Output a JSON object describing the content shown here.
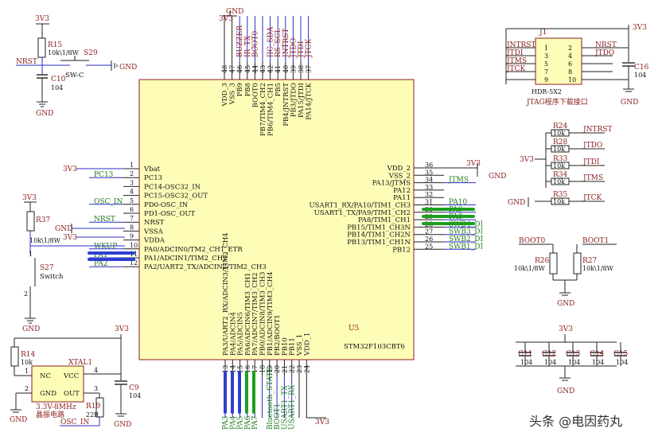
{
  "mcu": {
    "ref": "U5",
    "part": "STM32F103CBT6",
    "left_pins": [
      {
        "num": "1",
        "name": "Vbat"
      },
      {
        "num": "2",
        "name": "PC13"
      },
      {
        "num": "3",
        "name": "PC14-OSC32_IN"
      },
      {
        "num": "4",
        "name": "PC15-OSC32_OUT"
      },
      {
        "num": "5",
        "name": "PD0-OSC_IN"
      },
      {
        "num": "6",
        "name": "PD1-OSC_OUT"
      },
      {
        "num": "7",
        "name": "NRST"
      },
      {
        "num": "8",
        "name": "VSSA"
      },
      {
        "num": "9",
        "name": "VDDA"
      },
      {
        "num": "10",
        "name": "PA0/ADCIN0/TM2_CH1_ETR"
      },
      {
        "num": "11",
        "name": "PA1/ADCIN1/TIM2_CH2"
      },
      {
        "num": "12",
        "name": "PA2/UART2_TX/ADCIN2/TIM2_CH3"
      }
    ],
    "right_pins": [
      {
        "num": "36",
        "name": "VDD_2"
      },
      {
        "num": "35",
        "name": "VSS_2"
      },
      {
        "num": "34",
        "name": "PA13/JTMS"
      },
      {
        "num": "33",
        "name": "PA12"
      },
      {
        "num": "32",
        "name": "PA11"
      },
      {
        "num": "31",
        "name": "USART1_RX/PA10/TIM1_CH3"
      },
      {
        "num": "30",
        "name": "USART1_TX/PA9/TIM1_CH2"
      },
      {
        "num": "29",
        "name": "PA8/TIM1_CH1"
      },
      {
        "num": "28",
        "name": "PB15/TIM1_CH3N"
      },
      {
        "num": "27",
        "name": "PB14/TIM1_CH2N"
      },
      {
        "num": "26",
        "name": "PB13/TIM1_CH1N"
      },
      {
        "num": "25",
        "name": "PB12"
      }
    ],
    "top_pins": [
      {
        "num": "48",
        "name": "VDD_3"
      },
      {
        "num": "47",
        "name": "VSS_3"
      },
      {
        "num": "46",
        "name": "PB9"
      },
      {
        "num": "45",
        "name": "PB8"
      },
      {
        "num": "44",
        "name": "BOOT0"
      },
      {
        "num": "43",
        "name": "PB7/TIM4_CH2"
      },
      {
        "num": "42",
        "name": "PB6/TIM4_CH1"
      },
      {
        "num": "41",
        "name": "PB5"
      },
      {
        "num": "40",
        "name": "PB4/JNTRST"
      },
      {
        "num": "39",
        "name": "PB3/JTDO"
      },
      {
        "num": "38",
        "name": "PA15/JTDI"
      },
      {
        "num": "37",
        "name": "PA14/JTCK"
      }
    ],
    "bottom_pins": [
      {
        "num": "13",
        "name": "PA3/UART2_RX/ADCIN3/TIM2_CH4"
      },
      {
        "num": "14",
        "name": "PA4/ADCIN4"
      },
      {
        "num": "15",
        "name": "PA5/ADCIN5"
      },
      {
        "num": "16",
        "name": "PA6/ADCIN6/TIM3_CH1"
      },
      {
        "num": "17",
        "name": "PA7/ADCIN7/TIM3_CH2"
      },
      {
        "num": "18",
        "name": "PB0/ADCIN8/TIM3_CH3"
      },
      {
        "num": "19",
        "name": "PB1/ADCIN9/TIM3_CH4"
      },
      {
        "num": "20",
        "name": "PB2/BOOT1"
      },
      {
        "num": "21",
        "name": "PB10"
      },
      {
        "num": "22",
        "name": "PB11"
      },
      {
        "num": "23",
        "name": "VSS_1"
      },
      {
        "num": "24",
        "name": "VDD_1"
      }
    ],
    "top_nets": [
      "",
      "",
      "BUZZER",
      "IR_TX",
      "BOOT0",
      "",
      "IIC_SDA",
      "RS_SCL",
      "JNTRST",
      "JTDO",
      "JTDI",
      "JTCK"
    ],
    "bottom_nets": [
      "PA3",
      "PA4",
      "PA5",
      "PA6",
      "PA7",
      "",
      "Bluetooth_STATE",
      "BOOT1",
      "USART1_TX",
      "USART1_RX",
      "",
      ""
    ],
    "right_nets": [
      "",
      "",
      "JTMS",
      "",
      "",
      "PA10",
      "PA9",
      "PA8",
      "SWB4_DI",
      "SWB3_DI",
      "SWB2_DI",
      "SWB1_DI"
    ],
    "left_nets": [
      "",
      "PC13",
      "",
      "",
      "OSC_IN",
      "",
      "NRST",
      "",
      "",
      "WKUP",
      "PA1",
      "PA2"
    ]
  },
  "power": {
    "v33": "3V3",
    "gnd": "GND"
  },
  "reset": {
    "r_ref": "R15",
    "r_val": "10k\\1/8W",
    "sw_ref": "S29",
    "sw_val": "SW-C",
    "c_ref": "C10",
    "c_val": "104",
    "net": "NRST"
  },
  "wakeup": {
    "r_ref": "R37",
    "r_val": "10k\\1/8W",
    "sw_ref": "S27",
    "sw_val": "Switch",
    "pin1": "1",
    "pin2": "2"
  },
  "crystal": {
    "r_ref": "R14",
    "r_val": "10k",
    "x_ref": "XTAL1",
    "nc": "NC",
    "vcc": "VCC",
    "gnd": "GND",
    "out": "OUT",
    "pins": [
      "1",
      "4",
      "2",
      "3"
    ],
    "desc": "3.3V-8MHz",
    "desc_cn": "晶振电路",
    "c_ref": "C9",
    "c_val": "104",
    "rs_ref": "R19",
    "rs_val": "22R",
    "net": "OSC_IN"
  },
  "jtag": {
    "ref": "J1",
    "part": "HDR-5X2",
    "desc": "JTAG程序下载接口",
    "left_nets": [
      "JNTRST",
      "JTDI",
      "JTMS",
      "JTCK",
      ""
    ],
    "left_nums": [
      "1",
      "3",
      "5",
      "7",
      "9"
    ],
    "right_nums": [
      "2",
      "4",
      "6",
      "8",
      "10"
    ],
    "right_nets": [
      "NRST",
      "JTDO",
      "",
      "",
      ""
    ],
    "c_ref": "C16",
    "c_val": "104"
  },
  "pullups": [
    {
      "ref": "R24",
      "val": "10k",
      "net": "JNTRST"
    },
    {
      "ref": "R28",
      "val": "10k",
      "net": "JTDO"
    },
    {
      "ref": "R33",
      "val": "10k",
      "net": "JTDI"
    },
    {
      "ref": "R34",
      "val": "10k",
      "net": "JTMS"
    },
    {
      "ref": "R35",
      "val": "10k",
      "net": "JTCK"
    }
  ],
  "boot": {
    "net0": "BOOT0",
    "net1": "BOOT1",
    "r0_ref": "R26",
    "r0_val": "10k\\1/8W",
    "r1_ref": "R27",
    "r1_val": "10k\\1/8W"
  },
  "decoupling": [
    {
      "ref": "C11",
      "val": "104"
    },
    {
      "ref": "C12",
      "val": "104"
    },
    {
      "ref": "C13",
      "val": "104"
    },
    {
      "ref": "C14",
      "val": "104"
    },
    {
      "ref": "C15",
      "val": "104"
    }
  ],
  "watermark": "头条 @电因药丸"
}
